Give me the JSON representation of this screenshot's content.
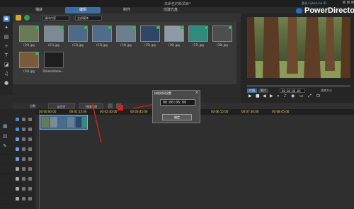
{
  "window": {
    "title": "未命名的新項目*",
    "account": "登录 CyberLink ID",
    "brand": "PowerDirector"
  },
  "tabs": [
    {
      "label": "捕获",
      "active": false
    },
    {
      "label": "编辑",
      "active": true
    },
    {
      "label": "制作",
      "active": false
    },
    {
      "label": "创建光盘",
      "active": false
    }
  ],
  "library": {
    "filter": "媒体内容",
    "sort": "全部媒体",
    "items": [
      {
        "label": "(10).jpg",
        "color": "#6a7a55"
      },
      {
        "label": "(11).jpg",
        "color": "#7b8a95"
      },
      {
        "label": "(12).jpg",
        "color": "#4d6a88"
      },
      {
        "label": "(13).jpg",
        "color": "#4f6d8b"
      },
      {
        "label": "(14).jpg",
        "color": "#6a808f"
      },
      {
        "label": "(15).jpg",
        "color": "#2e4766"
      },
      {
        "label": "(16).jpg",
        "color": "#8e9ba6"
      },
      {
        "label": "(17).jpg",
        "color": "#2f8a80"
      },
      {
        "label": "(18).jpg",
        "color": "#4e4e4e"
      },
      {
        "label": "(19).jpg",
        "color": "#7a5a3a"
      },
      {
        "label": "Dreamstable-...",
        "color": "#1e1e1e"
      }
    ]
  },
  "preview": {
    "mode_clip": "片段",
    "mode_movie": "影片",
    "timecode": "00:00:00.00",
    "fit_label": "适合大小"
  },
  "editbar": {
    "split": "分割",
    "title_btn": "幻灯片",
    "duration_btn": "持续时间"
  },
  "ruler": [
    "00:00:00:00",
    "00:01:15:00",
    "00:02:30:00",
    "00:03:45:00",
    "00:05:00:00",
    "00:06:15:00",
    "00:07:30:00",
    "00:08:45:00"
  ],
  "dialog": {
    "title": "持续时间设置",
    "close": "×",
    "timecode": "00:00:06:00",
    "ok": "确定"
  },
  "colors": {
    "accent": "#3b6ea5",
    "annotation": "#d42020"
  }
}
